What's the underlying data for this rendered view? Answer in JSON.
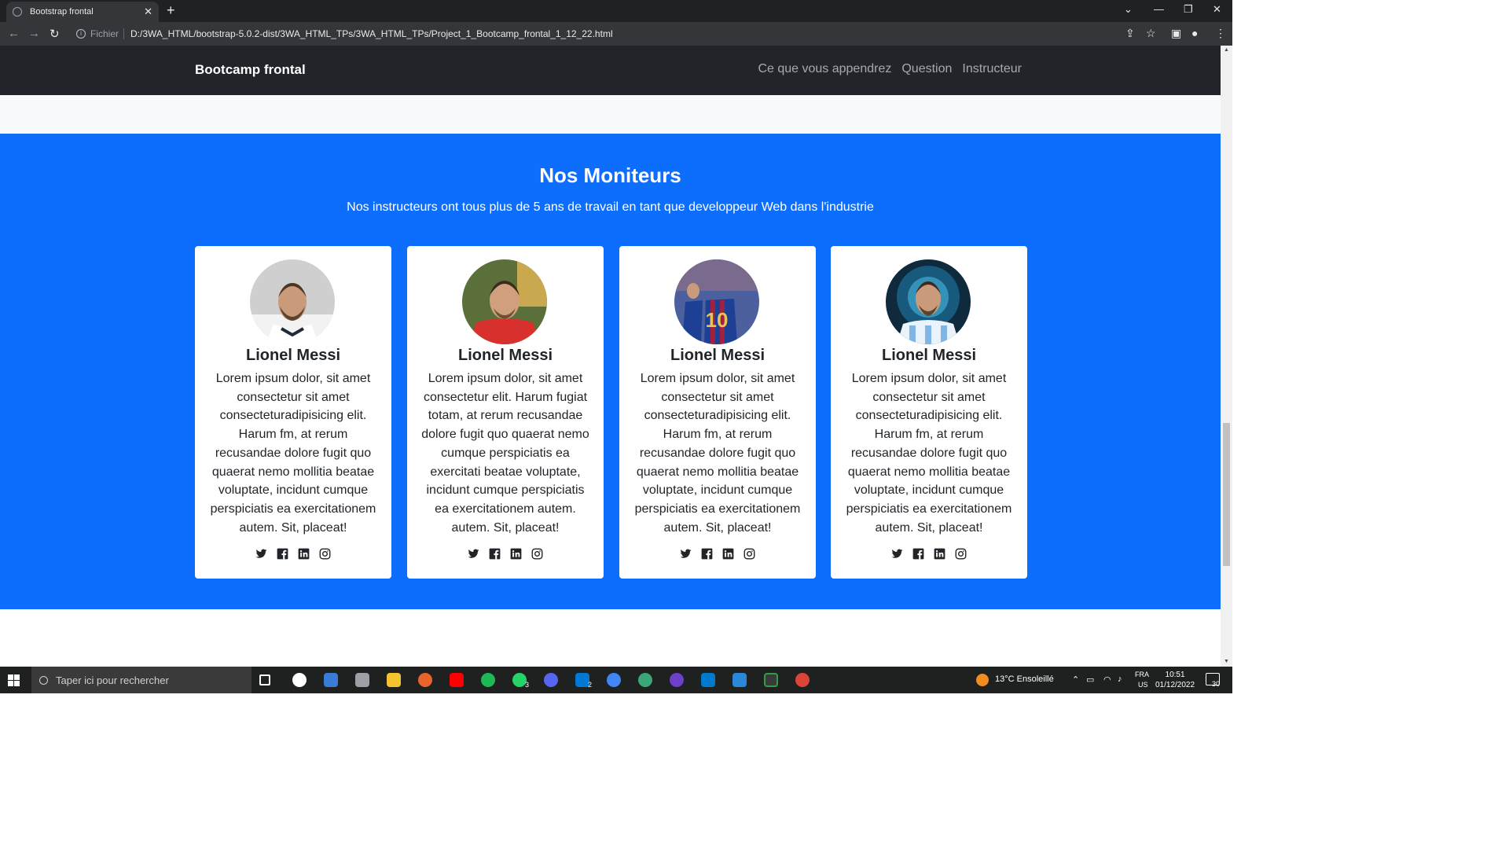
{
  "browser": {
    "tab_title": "Bootstrap frontal",
    "new_tab_label": "+",
    "scheme_label": "Fichier",
    "url": "D:/3WA_HTML/bootstrap-5.0.2-dist/3WA_HTML_TPs/3WA_HTML_TPs/Project_1_Bootcamp_frontal_1_12_22.html"
  },
  "site_nav": {
    "brand": "Bootcamp frontal",
    "links": [
      "Ce que vous appendrez",
      "Question",
      "Instructeur"
    ]
  },
  "instructors": {
    "title": "Nos Moniteurs",
    "subtitle": "Nos instructeurs ont tous plus de 5 ans de travail en tant que developpeur Web dans l'industrie",
    "bg_color": "#0d6efd",
    "cards": [
      {
        "name": "Lionel Messi",
        "text": "Lorem ipsum dolor, sit amet consectetur sit amet consecteturadipisicing elit. Harum fm, at rerum recusandae dolore fugit quo quaerat nemo mollitia beatae voluptate, incidunt cumque perspiciatis ea exercitationem autem. Sit, placeat!",
        "socials": [
          "twitter-icon",
          "facebook-icon",
          "linkedin-icon",
          "instagram-icon"
        ]
      },
      {
        "name": "Lionel Messi",
        "text": "Lorem ipsum dolor, sit amet consectetur elit. Harum fugiat totam, at rerum recusandae dolore fugit quo quaerat nemo cumque perspiciatis ea exercitati beatae voluptate, incidunt cumque perspiciatis ea exercitationem autem. autem. Sit, placeat!",
        "socials": [
          "twitter-icon",
          "facebook-icon",
          "linkedin-icon",
          "instagram-icon"
        ]
      },
      {
        "name": "Lionel Messi",
        "text": "Lorem ipsum dolor, sit amet consectetur sit amet consecteturadipisicing elit. Harum fm, at rerum recusandae dolore fugit quo quaerat nemo mollitia beatae voluptate, incidunt cumque perspiciatis ea exercitationem autem. Sit, placeat!",
        "socials": [
          "twitter-icon",
          "facebook-icon",
          "linkedin-icon",
          "instagram-icon"
        ]
      },
      {
        "name": "Lionel Messi",
        "text": "Lorem ipsum dolor, sit amet consectetur sit amet consecteturadipisicing elit. Harum fm, at rerum recusandae dolore fugit quo quaerat nemo mollitia beatae voluptate, incidunt cumque perspiciatis ea exercitationem autem. Sit, placeat!",
        "socials": [
          "twitter-icon",
          "facebook-icon",
          "linkedin-icon",
          "instagram-icon"
        ]
      }
    ]
  },
  "taskbar": {
    "search_placeholder": "Taper ici pour rechercher",
    "weather": "13°C  Ensoleillé",
    "lang_top": "FRA",
    "lang_bottom": "US",
    "time": "10:51",
    "date": "01/12/2022",
    "notifications": "30",
    "whatsapp_badge": "3",
    "mail_badge": "2"
  }
}
